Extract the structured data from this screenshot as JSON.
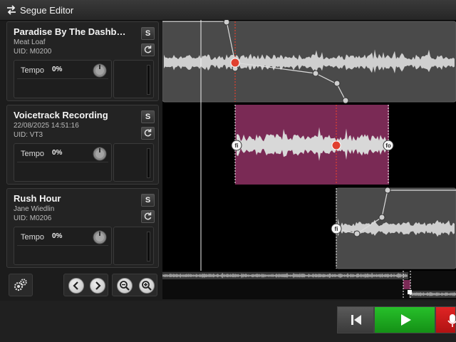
{
  "window": {
    "title": "Segue Editor",
    "icon": "swap-arrows-icon"
  },
  "tracks": [
    {
      "title": "Paradise By The Dashb…",
      "artist": "Meat Loaf",
      "uid": "UID: M0200",
      "solo_label": "S",
      "tempo_label": "Tempo",
      "tempo_value": "0%"
    },
    {
      "title": "Voicetrack Recording",
      "artist": "22/08/2025 14:51:16",
      "uid": "UID: VT3",
      "solo_label": "S",
      "tempo_label": "Tempo",
      "tempo_value": "0%"
    },
    {
      "title": "Rush Hour",
      "artist": "Jane Wiedlin",
      "uid": "UID: M0206",
      "solo_label": "S",
      "tempo_label": "Tempo",
      "tempo_value": "0%"
    }
  ],
  "markers": {
    "fade_in": "fi",
    "fade_out": "fo"
  },
  "toolbar": {
    "settings_icon": "gears-icon",
    "scroll_left_icon": "chevron-left-icon",
    "scroll_right_icon": "chevron-right-icon",
    "zoom_out_icon": "zoom-out-icon",
    "zoom_in_icon": "zoom-in-icon"
  },
  "transport": {
    "rewind_icon": "skip-back-icon",
    "play_icon": "play-icon",
    "record_icon": "microphone-icon",
    "play_color": "#17a51a",
    "record_color": "#c21616"
  },
  "colors": {
    "voicetrack_region": "#7a2a55",
    "music_region": "#4a4a4a",
    "cue_marker": "#e04030"
  }
}
